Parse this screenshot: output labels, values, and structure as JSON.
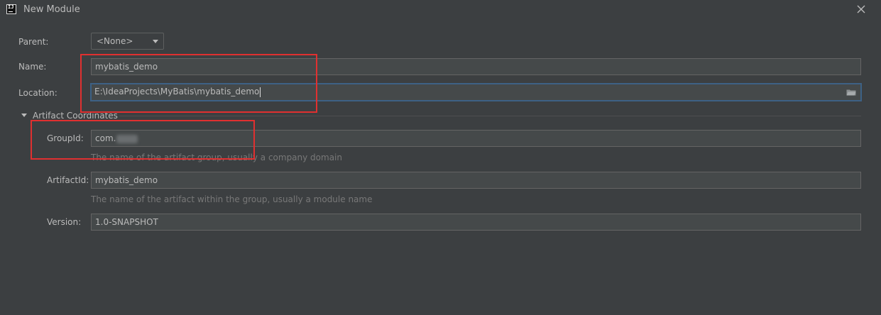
{
  "window": {
    "title": "New Module",
    "logo_text": "IJ"
  },
  "form": {
    "parent_label": "Parent:",
    "parent_value": "<None>",
    "name_label": "Name:",
    "name_value": "mybatis_demo",
    "location_label": "Location:",
    "location_value": "E:\\IdeaProjects\\MyBatis\\mybatis_demo"
  },
  "artifact": {
    "section_title": "Artifact Coordinates",
    "groupid_label": "GroupId:",
    "groupid_value": "com.",
    "groupid_hint": "The name of the artifact group, usually a company domain",
    "artifactid_label": "ArtifactId:",
    "artifactid_value": "mybatis_demo",
    "artifactid_hint": "The name of the artifact within the group, usually a module name",
    "version_label": "Version:",
    "version_value": "1.0-SNAPSHOT"
  },
  "icons": {
    "close": "close-icon",
    "folder": "folder-icon",
    "expand": "triangle-down-icon",
    "logo": "intellij-logo-icon"
  },
  "colors": {
    "background": "#3c3f41",
    "field_bg": "#45494a",
    "focus_border": "#3d6185",
    "annotation_red": "#e03030",
    "hint_text": "#787878"
  }
}
